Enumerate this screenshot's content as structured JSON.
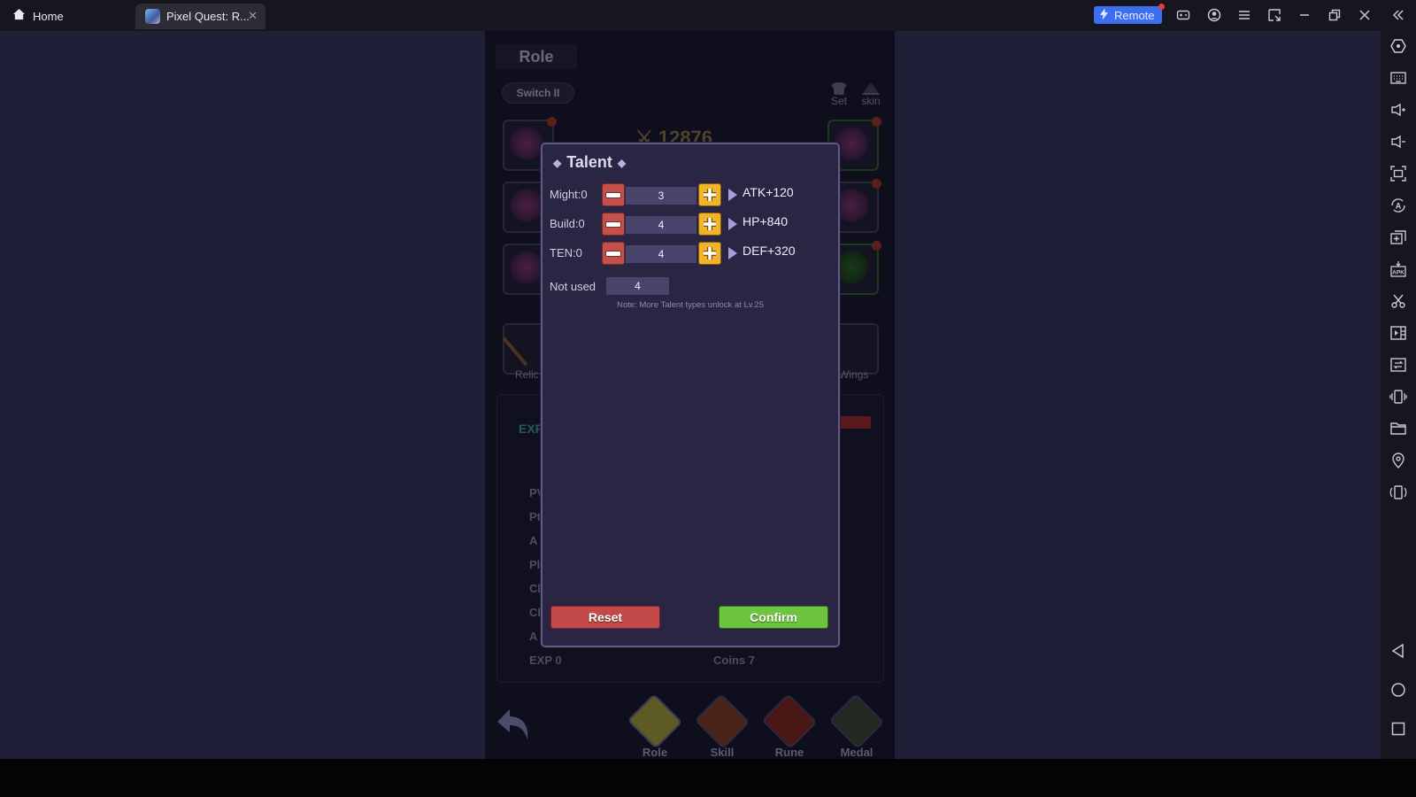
{
  "titlebar": {
    "home_label": "Home",
    "tab_title": "Pixel Quest: R...",
    "remote_label": "Remote",
    "icons": [
      "gamepad-icon",
      "account-icon",
      "menu-icon",
      "resize-icon",
      "minimize-icon",
      "restore-icon",
      "close-icon",
      "collapse-sidebar-icon"
    ]
  },
  "sidebar": {
    "icons": [
      "settings-hex-icon",
      "keyboard-icon",
      "volume-up-icon",
      "volume-down-icon",
      "screenshot-frame-icon",
      "auto-rotate-icon",
      "multi-instance-icon",
      "install-apk-icon",
      "cut-icon",
      "media-icon",
      "sync-icon",
      "shake-icon",
      "folder-icon",
      "location-icon",
      "rotate-device-icon",
      "back-icon",
      "home-circle-icon",
      "recents-square-icon"
    ]
  },
  "game": {
    "screen_title": "Role",
    "switch_label": "Switch II",
    "set_label": "Set",
    "skin_label": "skin",
    "power_value": "12876",
    "relic_label": "Relic",
    "wings_label": "Wings",
    "exp_label": "EXP",
    "stat_rows": [
      "PV",
      "Pt",
      "A",
      "Pl",
      "Cl",
      "Cl",
      "A"
    ],
    "exp_value": "EXP 0",
    "coins_value": "Coins 7",
    "nav": [
      {
        "label": "Role",
        "color": "#6d6a2a"
      },
      {
        "label": "Skill",
        "color": "#5a2a1a"
      },
      {
        "label": "Rune",
        "color": "#5a1a1a"
      },
      {
        "label": "Medal",
        "color": "#2a3024"
      }
    ]
  },
  "talent_dialog": {
    "title": "Talent",
    "rows": [
      {
        "label": "Might:0",
        "value": "3",
        "bonus": "ATK+120"
      },
      {
        "label": "Build:0",
        "value": "4",
        "bonus": "HP+840"
      },
      {
        "label": "TEN:0",
        "value": "4",
        "bonus": "DEF+320"
      }
    ],
    "not_used_label": "Not used",
    "not_used_value": "4",
    "note": "Note: More Talent types unlock at Lv.25",
    "reset_label": "Reset",
    "confirm_label": "Confirm"
  }
}
